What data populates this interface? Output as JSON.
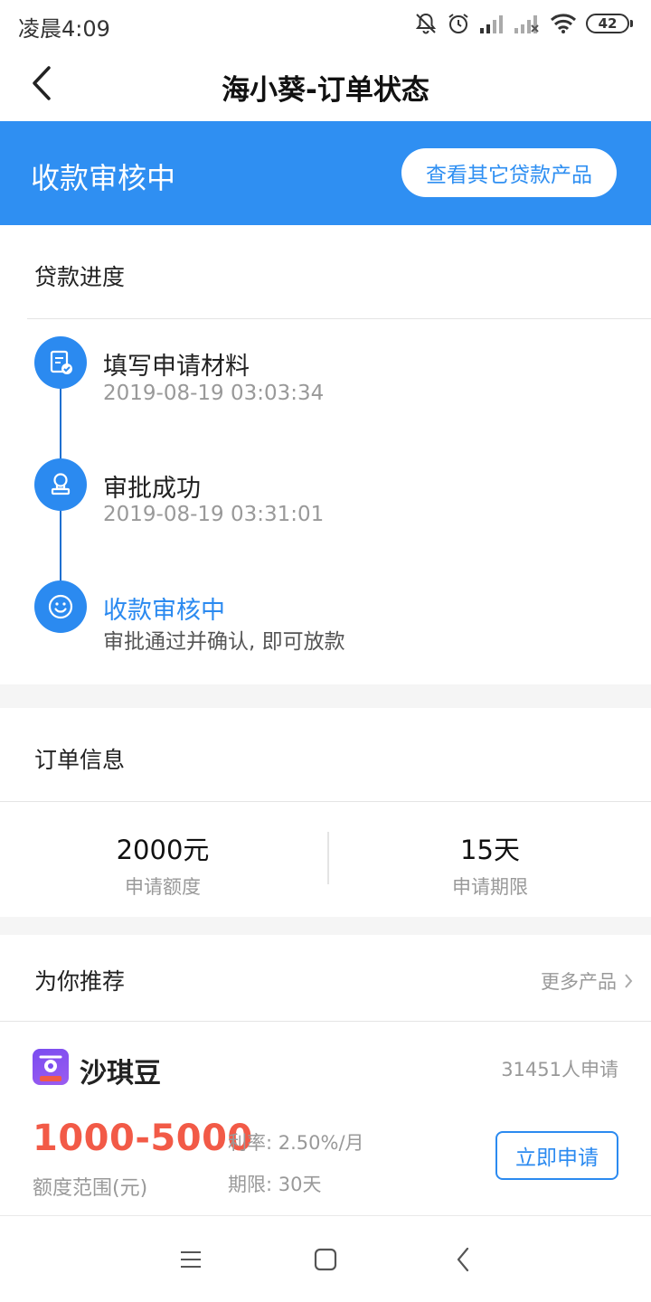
{
  "status_bar": {
    "time": "凌晨4:09",
    "battery": "42",
    "icons": [
      "mute-icon",
      "alarm-icon",
      "signal-icon",
      "signal-off-icon",
      "wifi-icon",
      "battery-icon"
    ]
  },
  "nav": {
    "title": "海小葵-订单状态",
    "back_icon": "chevron-left-icon"
  },
  "banner": {
    "status": "收款审核中",
    "button_label": "查看其它贷款产品"
  },
  "progress": {
    "title": "贷款进度",
    "steps": [
      {
        "title": "填写申请材料",
        "subtitle": "2019-08-19 03:03:34",
        "icon": "document-check-icon",
        "active": false
      },
      {
        "title": "审批成功",
        "subtitle": "2019-08-19 03:31:01",
        "icon": "stamp-icon",
        "active": false
      },
      {
        "title": "收款审核中",
        "subtitle": "审批通过并确认, 即可放款",
        "icon": "smile-icon",
        "active": true
      }
    ]
  },
  "order_info": {
    "title": "订单信息",
    "items": [
      {
        "value": "2000元",
        "label": "申请额度"
      },
      {
        "value": "15天",
        "label": "申请期限"
      }
    ]
  },
  "recommend": {
    "title": "为你推荐",
    "more_label": "更多产品",
    "product": {
      "name": "沙琪豆",
      "applicants": "31451人申请",
      "range": "1000-5000",
      "range_label": "额度范围(元)",
      "rate": "利率: 2.50%/月",
      "term": "期限: 30天",
      "apply_label": "立即申请"
    }
  },
  "colors": {
    "primary": "#2f8ff2",
    "accent_red": "#f25a47",
    "text_gray": "#999999"
  },
  "system_nav": [
    "menu-icon",
    "home-icon",
    "back-icon"
  ]
}
